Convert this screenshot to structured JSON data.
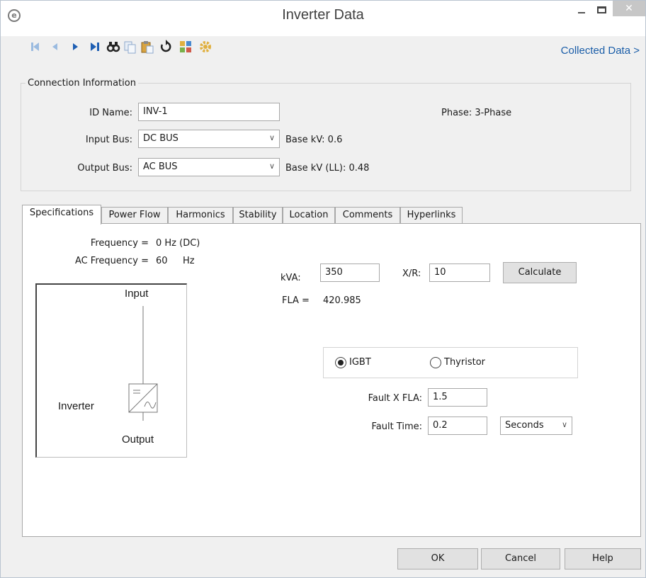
{
  "window": {
    "title": "Inverter Data",
    "close_glyph": "✕"
  },
  "toolbar": {
    "icons": [
      "first-record-icon",
      "previous-record-icon",
      "next-record-icon",
      "last-record-icon",
      "find-icon",
      "copy-icon",
      "paste-icon",
      "undo-icon",
      "save-library-icon",
      "settings-gear-icon"
    ],
    "collected_data": "Collected Data >"
  },
  "connection": {
    "legend": "Connection Information",
    "id_label": "ID Name:",
    "id_value": "INV-1",
    "phase_label": "Phase:",
    "phase_value": "3-Phase",
    "input_bus_label": "Input Bus:",
    "input_bus_value": "DC BUS",
    "base_kv_label": "Base kV:",
    "base_kv_value": "0.6",
    "output_bus_label": "Output Bus:",
    "output_bus_value": "AC BUS",
    "base_kv_ll_label": "Base kV (LL):",
    "base_kv_ll_value": "0.48"
  },
  "tabs": [
    "Specifications",
    "Power Flow",
    "Harmonics",
    "Stability",
    "Location",
    "Comments",
    "Hyperlinks"
  ],
  "specs": {
    "frequency_label": "Frequency =",
    "frequency_value": "0 Hz (DC)",
    "ac_frequency_label": "AC Frequency =",
    "ac_frequency_value": "60",
    "ac_frequency_unit": "Hz",
    "kva_label": "kVA:",
    "kva_value": "350",
    "xr_label": "X/R:",
    "xr_value": "10",
    "calculate": "Calculate",
    "fla_label": "FLA =",
    "fla_value": "420.985",
    "igbt_label": "IGBT",
    "thyristor_label": "Thyristor",
    "selected_type": "IGBT",
    "fault_x_fla_label": "Fault X FLA:",
    "fault_x_fla_value": "1.5",
    "fault_time_label": "Fault Time:",
    "fault_time_value": "0.2",
    "fault_time_unit": "Seconds",
    "diagram": {
      "input": "Input",
      "output": "Output",
      "device": "Inverter"
    }
  },
  "buttons": {
    "ok": "OK",
    "cancel": "Cancel",
    "help": "Help"
  }
}
